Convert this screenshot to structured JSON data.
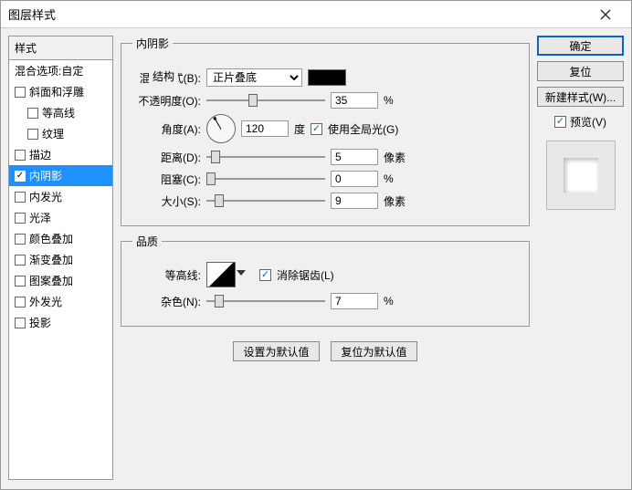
{
  "window": {
    "title": "图层样式"
  },
  "sidebar": {
    "header": "样式",
    "items": [
      {
        "label": "混合选项:自定",
        "checked": null,
        "indent": false
      },
      {
        "label": "斜面和浮雕",
        "checked": false,
        "indent": false
      },
      {
        "label": "等高线",
        "checked": false,
        "indent": true
      },
      {
        "label": "纹理",
        "checked": false,
        "indent": true
      },
      {
        "label": "描边",
        "checked": false,
        "indent": false
      },
      {
        "label": "内阴影",
        "checked": true,
        "indent": false,
        "selected": true
      },
      {
        "label": "内发光",
        "checked": false,
        "indent": false
      },
      {
        "label": "光泽",
        "checked": false,
        "indent": false
      },
      {
        "label": "颜色叠加",
        "checked": false,
        "indent": false
      },
      {
        "label": "渐变叠加",
        "checked": false,
        "indent": false
      },
      {
        "label": "图案叠加",
        "checked": false,
        "indent": false
      },
      {
        "label": "外发光",
        "checked": false,
        "indent": false
      },
      {
        "label": "投影",
        "checked": false,
        "indent": false
      }
    ]
  },
  "panel": {
    "title": "内阴影",
    "structure": {
      "label": "结构",
      "blend_mode": {
        "label": "混合模式(B):",
        "value": "正片叠底",
        "color": "#000000"
      },
      "opacity": {
        "label": "不透明度(O):",
        "value": "35",
        "unit": "%",
        "pct": 35
      },
      "angle": {
        "label": "角度(A):",
        "value": "120",
        "unit": "度"
      },
      "global": {
        "label": "使用全局光(G)",
        "checked": true
      },
      "distance": {
        "label": "距离(D):",
        "value": "5",
        "unit": "像素",
        "pct": 4
      },
      "choke": {
        "label": "阻塞(C):",
        "value": "0",
        "unit": "%",
        "pct": 0
      },
      "size": {
        "label": "大小(S):",
        "value": "9",
        "unit": "像素",
        "pct": 7
      }
    },
    "quality": {
      "label": "品质",
      "contour": {
        "label": "等高线:"
      },
      "antialias": {
        "label": "消除锯齿(L)",
        "checked": true
      },
      "noise": {
        "label": "杂色(N):",
        "value": "7",
        "unit": "%",
        "pct": 7
      }
    },
    "buttons": {
      "default": "设置为默认值",
      "reset": "复位为默认值"
    }
  },
  "right": {
    "ok": "确定",
    "cancel": "复位",
    "newstyle": "新建样式(W)...",
    "preview": {
      "label": "预览(V)",
      "checked": true
    }
  }
}
